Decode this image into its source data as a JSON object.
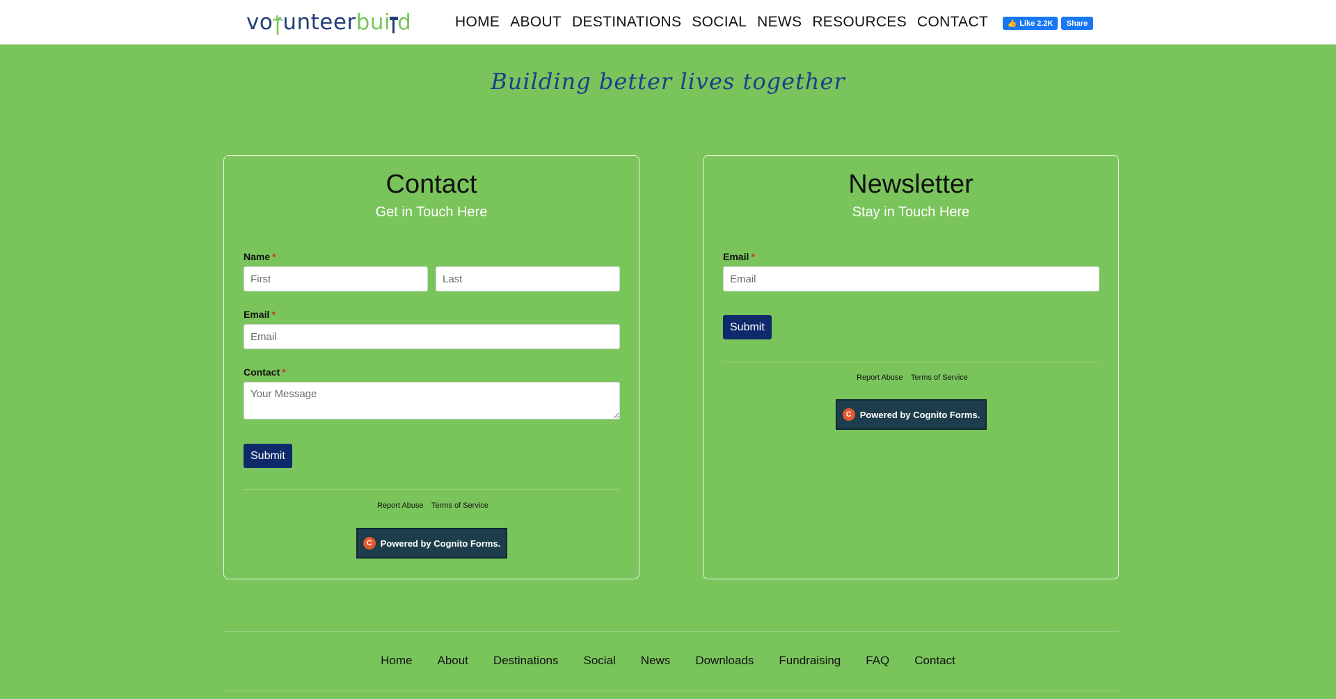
{
  "header": {
    "logo": {
      "part1": "vo",
      "part2": "unteer",
      "part3": "bui",
      "part4": "d"
    },
    "nav": [
      "HOME",
      "ABOUT",
      "DESTINATIONS",
      "SOCIAL",
      "NEWS",
      "RESOURCES",
      "CONTACT"
    ],
    "fb_like": "Like 2.2K",
    "fb_share": "Share"
  },
  "tagline": "Building better lives together",
  "contact": {
    "title": "Contact",
    "subtitle": "Get in Touch Here",
    "name_label": "Name",
    "first_placeholder": "First",
    "last_placeholder": "Last",
    "email_label": "Email",
    "email_placeholder": "Email",
    "contact_label": "Contact",
    "message_placeholder": "Your Message",
    "submit": "Submit",
    "report": "Report Abuse",
    "terms": "Terms of Service",
    "powered": "Powered by Cognito Forms."
  },
  "newsletter": {
    "title": "Newsletter",
    "subtitle": "Stay in Touch Here",
    "email_label": "Email",
    "email_placeholder": "Email",
    "submit": "Submit",
    "report": "Report Abuse",
    "terms": "Terms of Service",
    "powered": "Powered by Cognito Forms."
  },
  "footer": {
    "links": [
      "Home",
      "About",
      "Destinations",
      "Social",
      "News",
      "Downloads",
      "Fundraising",
      "FAQ",
      "Contact"
    ]
  },
  "colors": {
    "background": "#7ac45c",
    "primary": "#0f2a6b",
    "brand_blue": "#24407a"
  }
}
